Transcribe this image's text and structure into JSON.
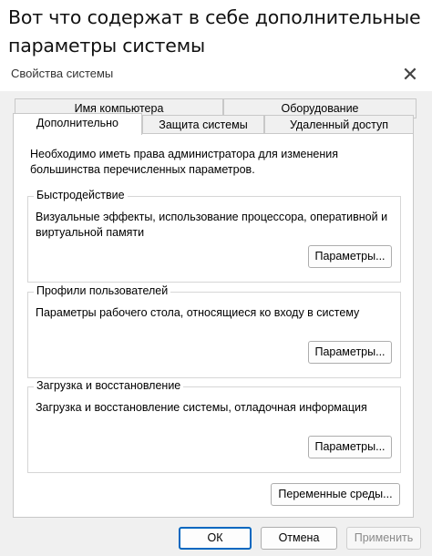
{
  "caption": {
    "line1": "Вот что содержат в себе дополнительные",
    "line2": "параметры системы"
  },
  "window": {
    "title": "Свойства системы",
    "close_glyph": "✕"
  },
  "tabs": {
    "computer_name": "Имя компьютера",
    "hardware": "Оборудование",
    "advanced": "Дополнительно",
    "protection": "Защита системы",
    "remote": "Удаленный доступ"
  },
  "intro_text": "Необходимо иметь права администратора для изменения большинства перечисленных параметров.",
  "performance": {
    "title": "Быстродействие",
    "description": "Визуальные эффекты, использование процессора, оперативной и виртуальной памяти",
    "button": "Параметры..."
  },
  "profiles": {
    "title": "Профили пользователей",
    "description": "Параметры рабочего стола, относящиеся ко входу в систему",
    "button": "Параметры..."
  },
  "startup": {
    "title": "Загрузка и восстановление",
    "description": "Загрузка и восстановление системы, отладочная информация",
    "button": "Параметры..."
  },
  "env_button": "Переменные среды...",
  "footer": {
    "ok": "ОК",
    "cancel": "Отмена",
    "apply": "Применить"
  }
}
